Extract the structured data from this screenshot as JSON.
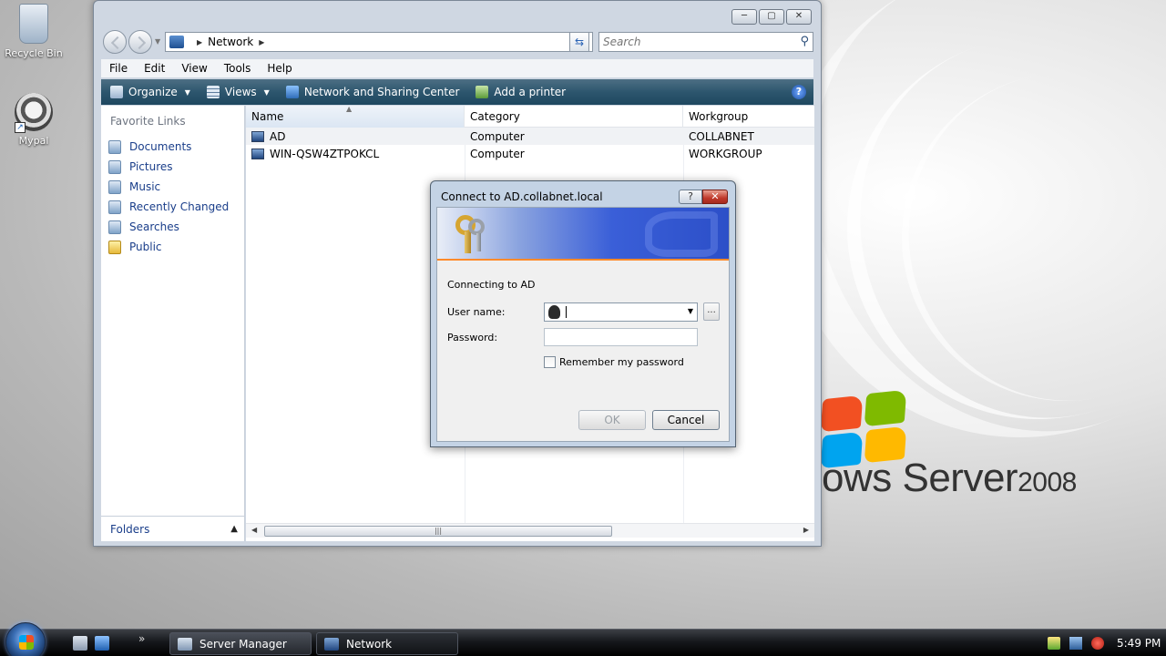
{
  "desktop": {
    "icons": [
      {
        "label": "Recycle Bin"
      },
      {
        "label": "Mypal"
      }
    ],
    "logo_text": "ows Server",
    "logo_year": "2008"
  },
  "explorer": {
    "address": {
      "crumb": "Network",
      "search_placeholder": "Search"
    },
    "menu": [
      "File",
      "Edit",
      "View",
      "Tools",
      "Help"
    ],
    "toolbar": {
      "organize": "Organize",
      "views": "Views",
      "network_sharing": "Network and Sharing Center",
      "add_printer": "Add a printer"
    },
    "nav_pane": {
      "heading": "Favorite Links",
      "items": [
        "Documents",
        "Pictures",
        "Music",
        "Recently Changed",
        "Searches",
        "Public"
      ],
      "folders_label": "Folders"
    },
    "columns": {
      "name": "Name",
      "category": "Category",
      "workgroup": "Workgroup"
    },
    "rows": [
      {
        "name": "AD",
        "category": "Computer",
        "workgroup": "COLLABNET"
      },
      {
        "name": "WIN-QSW4ZTPOKCL",
        "category": "Computer",
        "workgroup": "WORKGROUP"
      }
    ]
  },
  "dialog": {
    "title": "Connect to AD.collabnet.local",
    "connecting_text": "Connecting to AD",
    "username_label": "User name:",
    "password_label": "Password:",
    "username_value": "",
    "password_value": "",
    "remember_label": "Remember my password",
    "ok_label": "OK",
    "cancel_label": "Cancel",
    "browse_label": "..."
  },
  "taskbar": {
    "tasks": [
      "Server Manager",
      "Network"
    ],
    "clock": "5:49 PM"
  }
}
